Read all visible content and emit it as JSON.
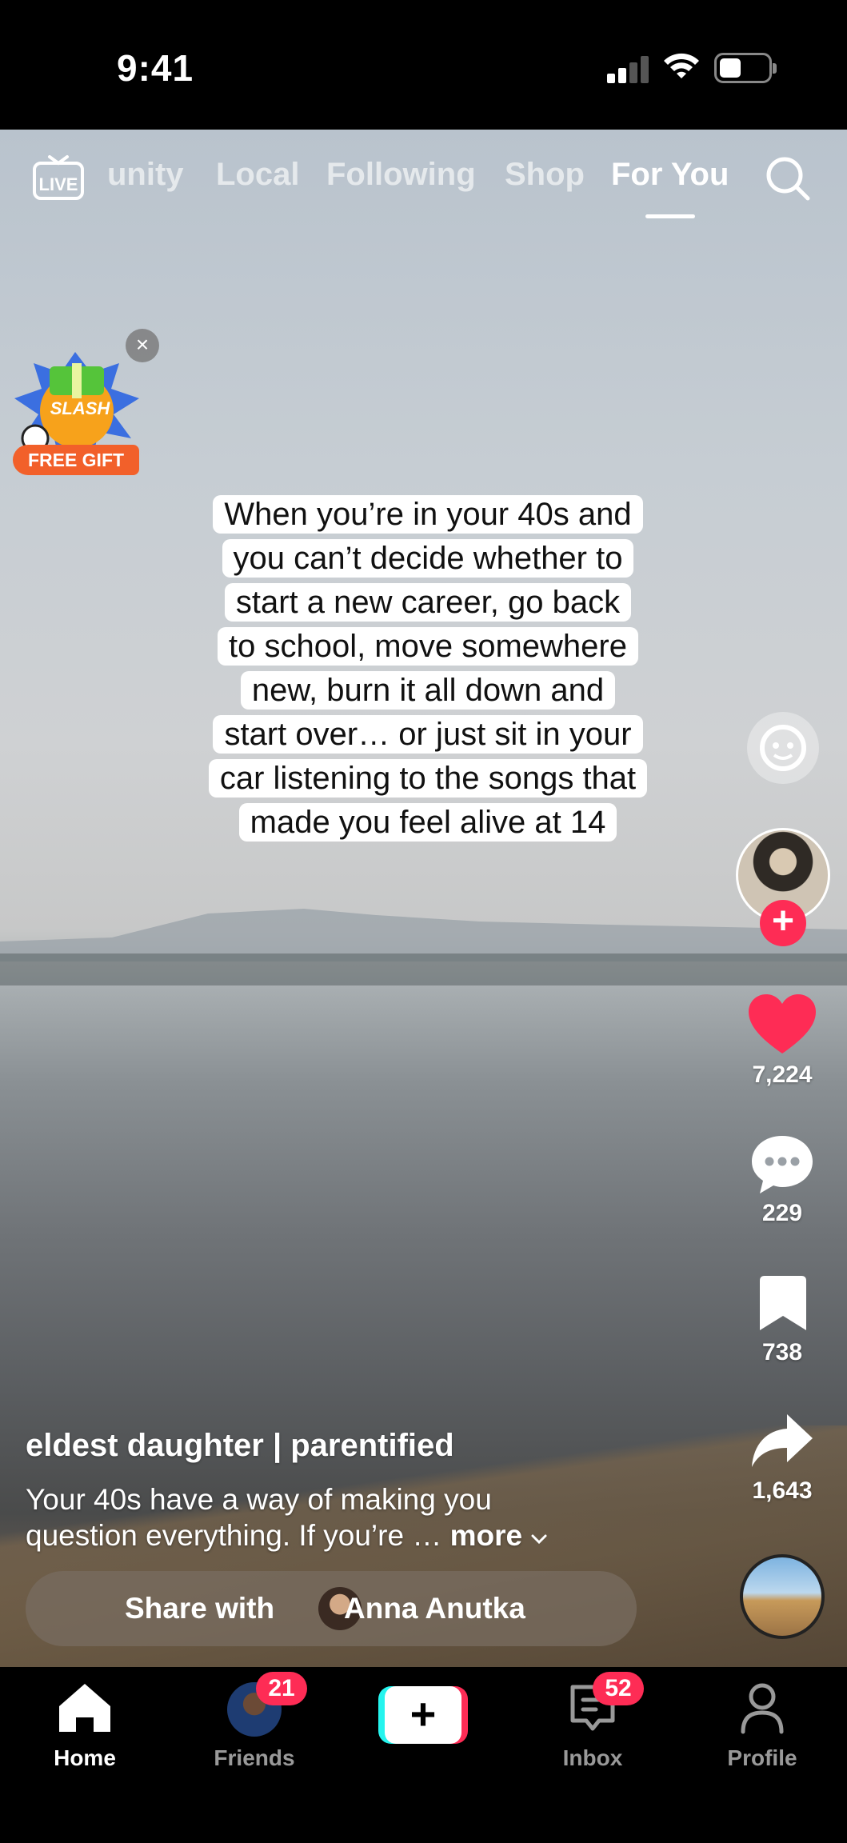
{
  "status_bar": {
    "time": "9:41"
  },
  "top_nav": {
    "live_label": "LIVE",
    "tabs": [
      "unity",
      "Local",
      "Following",
      "Shop",
      "For You"
    ],
    "active_tab": "For You"
  },
  "promo": {
    "title": "SLASH",
    "label": "FREE GIFT",
    "close": "×"
  },
  "video": {
    "caption_lines": [
      "When you’re in your 40s and",
      "you can’t decide whether to",
      "start a new career, go back",
      "to school, move somewhere",
      "new, burn it all down and",
      "start over… or just sit in your",
      "car listening to the songs that",
      "made you feel alive at 14"
    ]
  },
  "right_rail": {
    "follow_label": "+",
    "likes": "7,224",
    "comments": "229",
    "saves": "738",
    "shares": "1,643"
  },
  "post": {
    "username": "eldest daughter | parentified",
    "description_line1": "Your 40s have a way of making you",
    "description_line2": "question everything. If you’re …",
    "more_label": "more",
    "share_prefix": "Share with",
    "share_name": "Anna Anutka"
  },
  "tab_bar": {
    "home": "Home",
    "friends": "Friends",
    "friends_badge": "21",
    "create": "+",
    "inbox": "Inbox",
    "inbox_badge": "52",
    "profile": "Profile"
  },
  "colors": {
    "accent": "#fe2c55",
    "create_cyan": "#25f4ee",
    "heart": "#fe2c55"
  }
}
